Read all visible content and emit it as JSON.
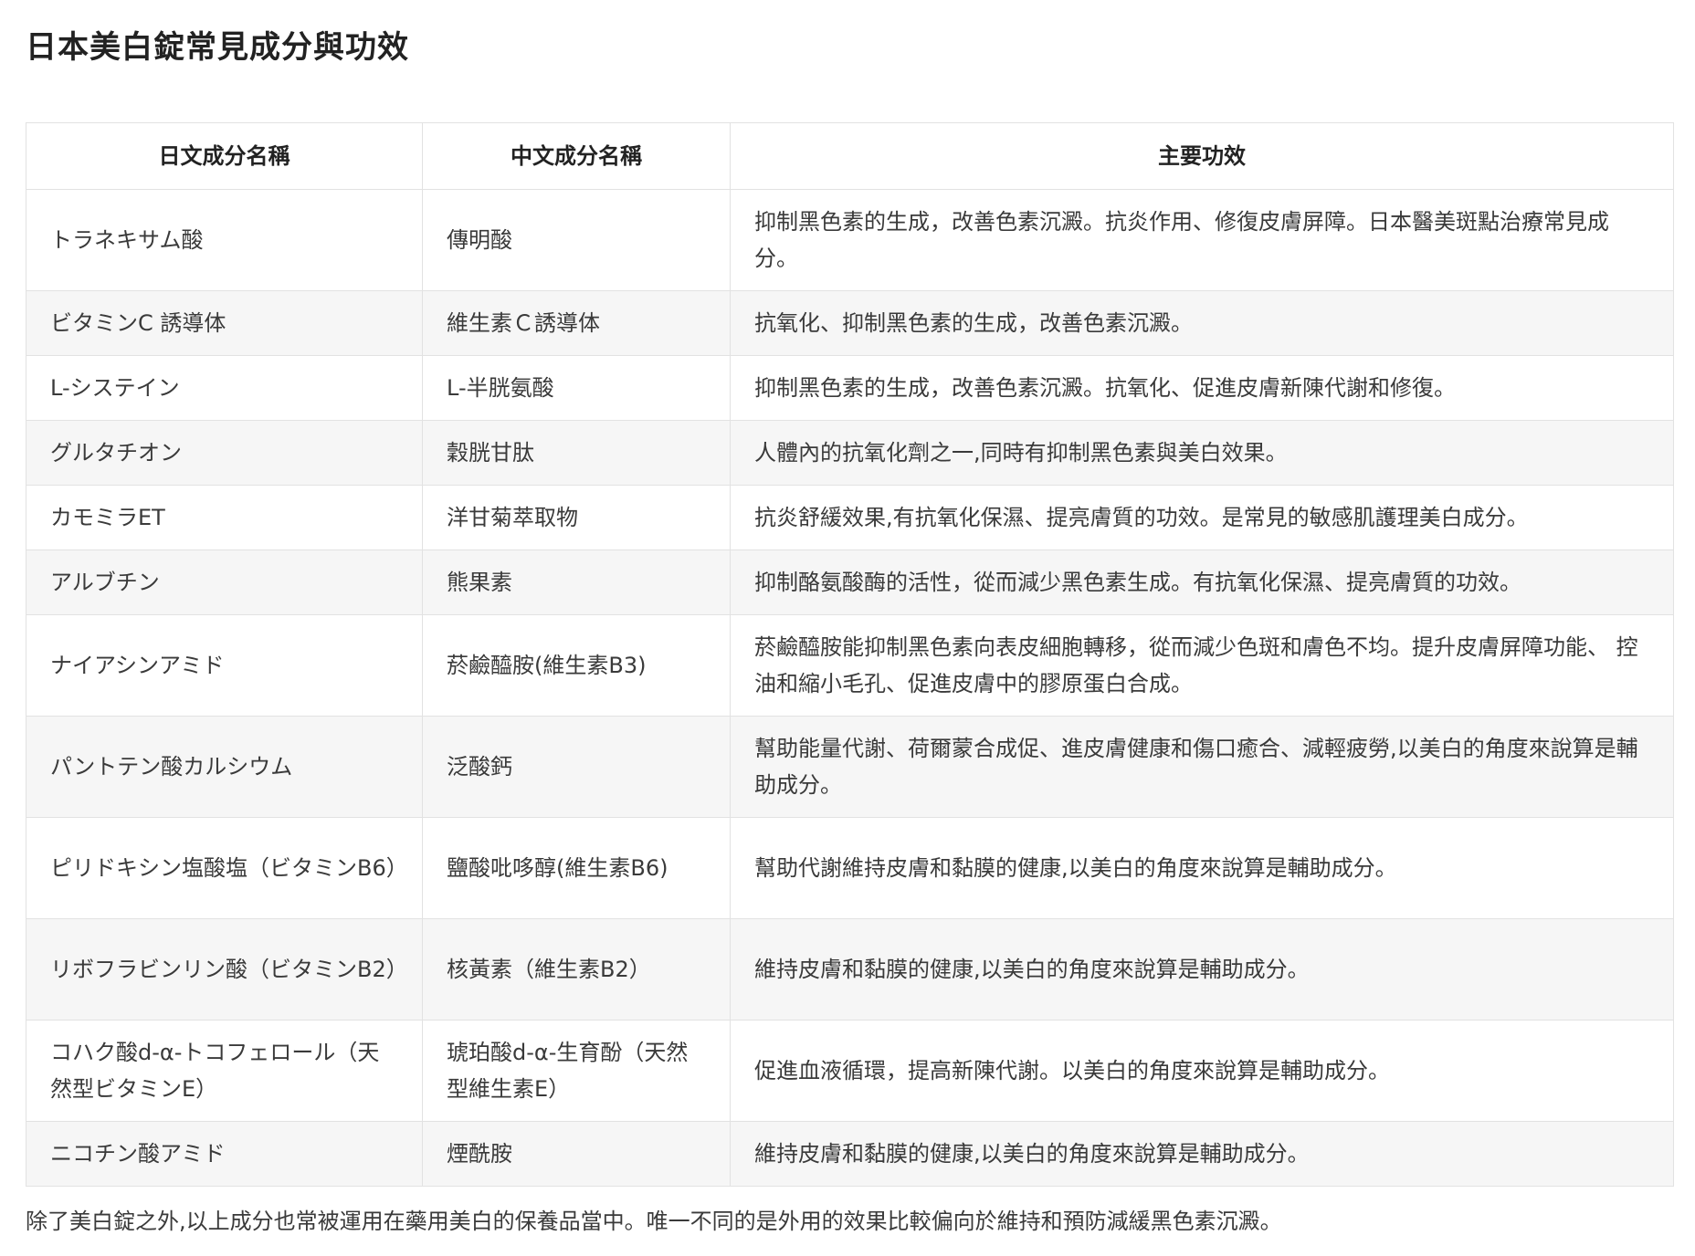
{
  "page": {
    "title": "日本美白錠常見成分與功效",
    "footer_note": "除了美白錠之外,以上成分也常被運用在藥用美白的保養品當中。唯一不同的是外用的效果比較偏向於維持和預防減緩黑色素沉澱。"
  },
  "table": {
    "headers": {
      "jp": "日文成分名稱",
      "cn": "中文成分名稱",
      "effect": "主要功效"
    },
    "rows": [
      {
        "jp": "トラネキサム酸",
        "cn": "傳明酸",
        "effect": "抑制黑色素的生成，改善色素沉澱。抗炎作用、修復皮膚屏障。日本醫美斑點治療常見成分。"
      },
      {
        "jp": "ビタミンC 誘導体",
        "cn": "維生素Ｃ誘導体",
        "effect": "抗氧化、抑制黑色素的生成，改善色素沉澱。"
      },
      {
        "jp": "L-システイン",
        "cn": "L-半胱氨酸",
        "effect": "抑制黑色素的生成，改善色素沉澱。抗氧化、促進皮膚新陳代謝和修復。"
      },
      {
        "jp": "グルタチオン",
        "cn": "穀胱甘肽",
        "effect": "人體內的抗氧化劑之一,同時有抑制黑色素與美白效果。"
      },
      {
        "jp": "カモミラET",
        "cn": "洋甘菊萃取物",
        "effect": "抗炎舒緩效果,有抗氧化保濕、提亮膚質的功效。是常見的敏感肌護理美白成分。"
      },
      {
        "jp": "アルブチン",
        "cn": "熊果素",
        "effect": "抑制酪氨酸酶的活性，從而減少黑色素生成。有抗氧化保濕、提亮膚質的功效。"
      },
      {
        "jp": "ナイアシンアミド",
        "cn": "菸鹼醯胺(維生素B3)",
        "effect": "菸鹼醯胺能抑制黑色素向表皮細胞轉移，從而減少色斑和膚色不均。提升皮膚屏障功能、 控油和縮小毛孔、促進皮膚中的膠原蛋白合成。"
      },
      {
        "jp": "パントテン酸カルシウム",
        "cn": "泛酸鈣",
        "effect": "幫助能量代謝、荷爾蒙合成促、進皮膚健康和傷口癒合、減輕疲勞,以美白的角度來說算是輔助成分。"
      },
      {
        "jp": "ピリドキシン塩酸塩（ビタミンB6）",
        "cn": "鹽酸吡哆醇(維生素B6)",
        "effect": "幫助代謝維持皮膚和黏膜的健康,以美白的角度來說算是輔助成分。"
      },
      {
        "jp": "リボフラビンリン酸（ビタミンB2）",
        "cn": "核黃素（維生素B2）",
        "effect": "維持皮膚和黏膜的健康,以美白的角度來說算是輔助成分。"
      },
      {
        "jp": "コハク酸d-α-トコフェロール（天然型ビタミンE）",
        "cn": "琥珀酸d-α-生育酚（天然型維生素E）",
        "effect": "促進血液循環，提高新陳代謝。以美白的角度來說算是輔助成分。"
      },
      {
        "jp": "ニコチン酸アミド",
        "cn": "煙酰胺",
        "effect": "維持皮膚和黏膜的健康,以美白的角度來說算是輔助成分。"
      }
    ]
  }
}
